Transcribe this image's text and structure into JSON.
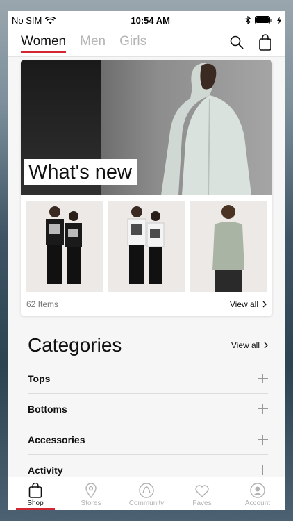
{
  "status_bar": {
    "carrier": "No SIM",
    "time": "10:54 AM"
  },
  "header": {
    "tabs": [
      {
        "label": "Women",
        "active": true
      },
      {
        "label": "Men",
        "active": false
      },
      {
        "label": "Girls",
        "active": false
      }
    ]
  },
  "featured": {
    "title": "What's new",
    "item_count": "62 Items",
    "view_all": "View all"
  },
  "categories": {
    "title": "Categories",
    "view_all": "View all",
    "items": [
      "Tops",
      "Bottoms",
      "Accessories",
      "Activity"
    ]
  },
  "tab_bar": {
    "items": [
      "Shop",
      "Stores",
      "Community",
      "Faves",
      "Account"
    ],
    "active": "Shop"
  },
  "colors": {
    "accent": "#d22630"
  }
}
